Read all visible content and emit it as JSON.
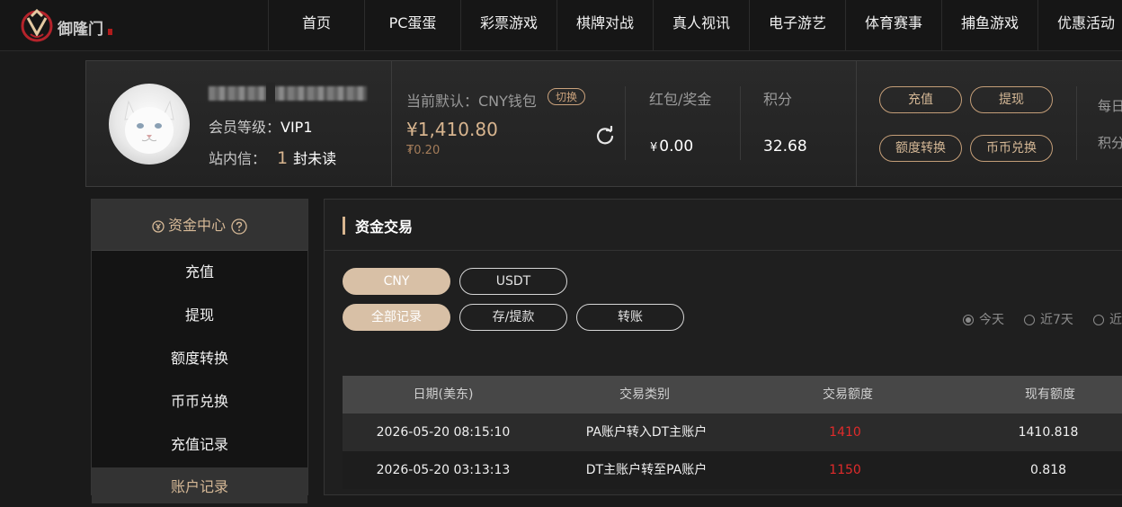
{
  "brand": {
    "name": "御隆门"
  },
  "nav": [
    {
      "label": "首页"
    },
    {
      "label": "PC蛋蛋"
    },
    {
      "label": "彩票游戏"
    },
    {
      "label": "棋牌对战"
    },
    {
      "label": "真人视讯"
    },
    {
      "label": "电子游艺"
    },
    {
      "label": "体育赛事"
    },
    {
      "label": "捕鱼游戏"
    },
    {
      "label": "优惠活动"
    }
  ],
  "profile": {
    "level_label": "会员等级：",
    "level_value": "VIP1",
    "inbox_label": "站内信：",
    "inbox_count": "1",
    "inbox_suffix": "封未读",
    "wallet_label": "当前默认：CNY钱包",
    "switch_label": "切换",
    "balance": "¥1,410.80",
    "balance_sub": "₮0.20",
    "bonus_label": "红包/奖金",
    "bonus_currency": "¥",
    "bonus_value": "0.00",
    "points_label": "积分",
    "points_value": "32.68",
    "actions": [
      {
        "label": "充值"
      },
      {
        "label": "提现"
      },
      {
        "label": "额度转换"
      },
      {
        "label": "币币兑换"
      }
    ],
    "daily_label": "每日",
    "daily_points_label": "积分"
  },
  "sidebar": {
    "header": "资金中心",
    "items": [
      {
        "label": "充值"
      },
      {
        "label": "提现"
      },
      {
        "label": "额度转换"
      },
      {
        "label": "币币兑换"
      },
      {
        "label": "充值记录"
      }
    ],
    "footer": "账户记录"
  },
  "main": {
    "title": "资金交易",
    "currency_tabs": [
      {
        "label": "CNY",
        "active": true
      },
      {
        "label": "USDT",
        "active": false
      }
    ],
    "type_tabs": [
      {
        "label": "全部记录",
        "active": true
      },
      {
        "label": "存/提款",
        "active": false
      },
      {
        "label": "转账",
        "active": false
      }
    ],
    "date_filters": [
      {
        "label": "今天",
        "selected": true
      },
      {
        "label": "近7天",
        "selected": false
      },
      {
        "label": "近",
        "selected": false
      }
    ],
    "table": {
      "columns": [
        "日期(美东)",
        "交易类别",
        "交易额度",
        "现有额度"
      ],
      "rows": [
        {
          "date": "2026-05-20 08:15:10",
          "type": "PA账户转入DT主账户",
          "amount": "1410",
          "balance": "1410.818"
        },
        {
          "date": "2026-05-20 03:13:13",
          "type": "DT主账户转至PA账户",
          "amount": "1150",
          "balance": "0.818"
        }
      ]
    }
  },
  "colors": {
    "accent_gold": "#d8b58f",
    "amount_red": "#e02b2b",
    "background": "#1a1a1a"
  },
  "icons": [
    "logo-mark-icon",
    "refresh-icon",
    "wallet-icon",
    "help-icon"
  ]
}
